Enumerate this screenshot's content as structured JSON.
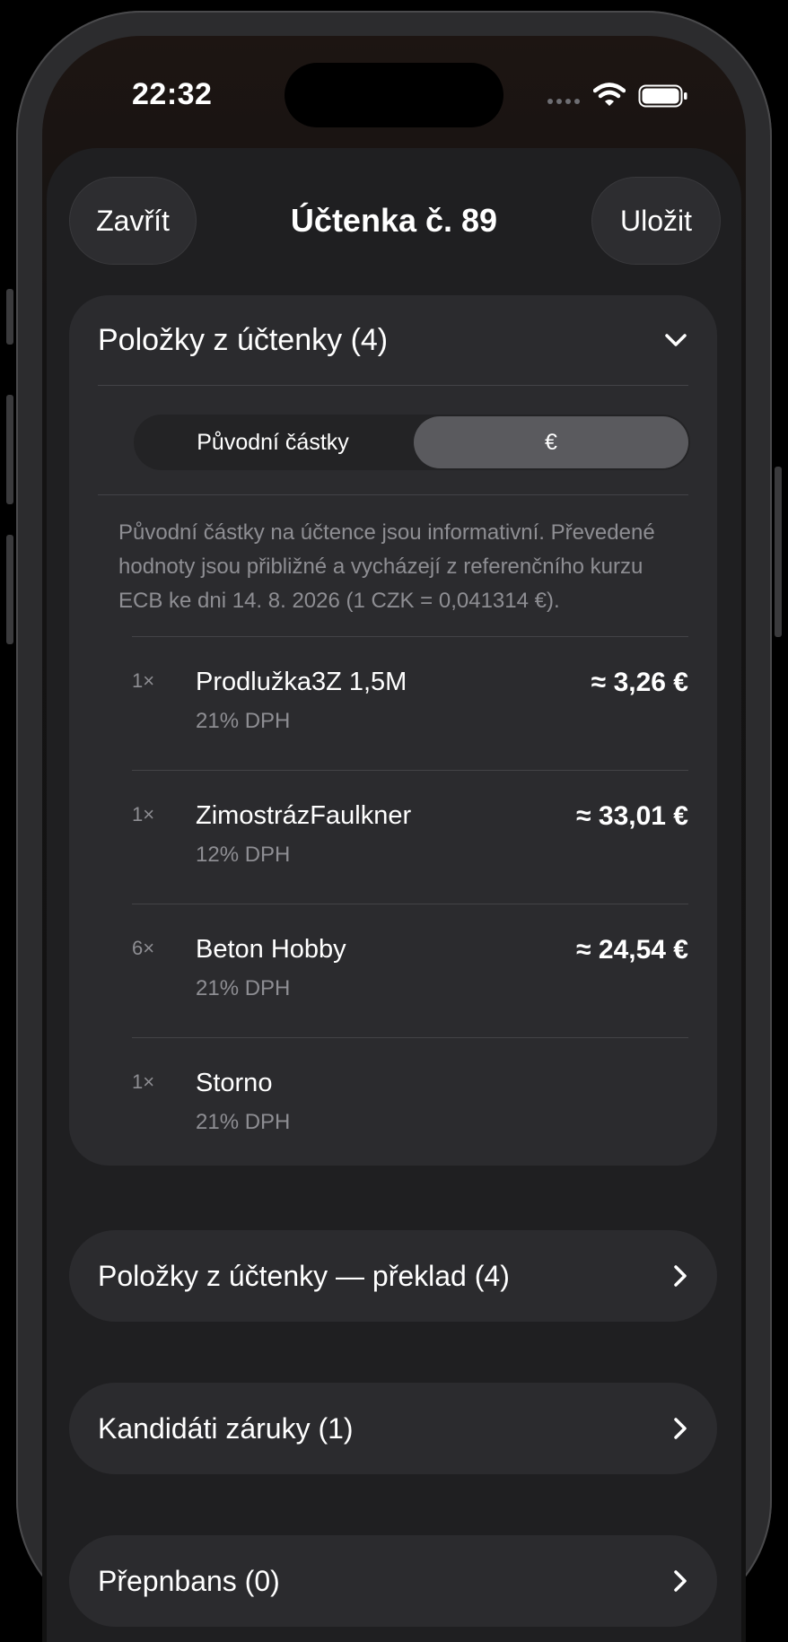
{
  "status_bar": {
    "time": "22:32"
  },
  "header": {
    "close_label": "Zavřít",
    "title": "Účtenka č. 89",
    "save_label": "Uložit"
  },
  "items_section": {
    "title": "Položky z účtenky (4)",
    "segments": [
      "Původní částky",
      "€"
    ],
    "active_segment": "€",
    "info": "Původní částky na účtence jsou informativní. Převedené hodnoty jsou přibližné a vycházejí z referenčního kurzu ECB ke dni 14. 8. 2026 (1 CZK = 0,041314 €).",
    "items": [
      {
        "qty": "1×",
        "name": "Prodlužka3Z 1,5M",
        "vat": "21% DPH",
        "price": "≈ 3,26 €"
      },
      {
        "qty": "1×",
        "name": "ZimostrázFaulkner",
        "vat": "12% DPH",
        "price": "≈ 33,01 €"
      },
      {
        "qty": "6×",
        "name": "Beton Hobby",
        "vat": "21% DPH",
        "price": "≈ 24,54 €"
      },
      {
        "qty": "1×",
        "name": "Storno",
        "vat": "21% DPH",
        "price": ""
      }
    ]
  },
  "sections": {
    "translation": "Položky z účtenky — překlad (4)",
    "warranty": "Kandidáti záruky (1)",
    "fourth": "Přepnbans (0)"
  },
  "colors": {
    "background": "#000000",
    "sheet": "#1f1f21",
    "card": "#2b2b2e",
    "active_segment": "#5a5a5e",
    "secondary_text": "#8e8e93"
  }
}
